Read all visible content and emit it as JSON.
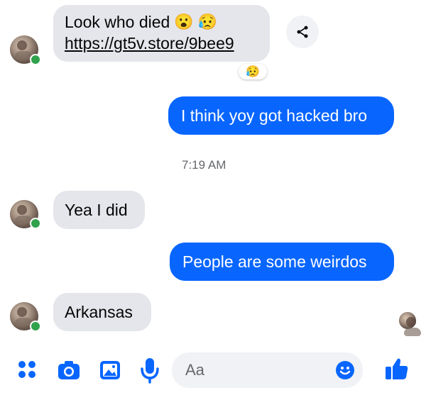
{
  "messages": {
    "m1": {
      "text": "Look who died",
      "emoji": "😮 😥",
      "link": "https://gt5v.store/9bee9",
      "reaction": "😥"
    },
    "m2": {
      "text": "I think yoy got hacked bro"
    },
    "timestamp": "7:19 AM",
    "m3": {
      "text": "Yea I did"
    },
    "m4": {
      "text": "People are some weirdos"
    },
    "m5": {
      "text": "Arkansas"
    }
  },
  "composer": {
    "placeholder": "Aa"
  },
  "colors": {
    "sent_bubble": "#0866ff",
    "received_bubble": "#e4e6eb",
    "online": "#31a24c",
    "accent": "#0866ff"
  },
  "icons": {
    "share": "share-icon",
    "apps": "apps-grid-icon",
    "camera": "camera-icon",
    "gallery": "gallery-icon",
    "mic": "microphone-icon",
    "emoji": "emoji-icon",
    "like": "thumbs-up-icon"
  }
}
